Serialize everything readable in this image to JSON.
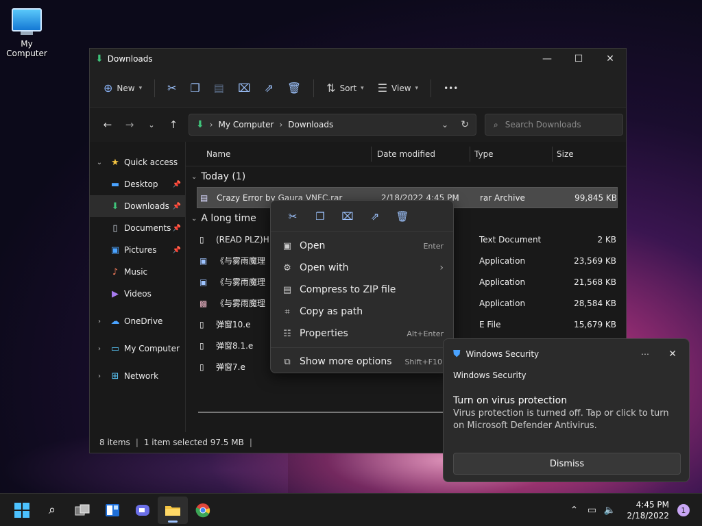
{
  "desktop": {
    "icon_label": "My Computer"
  },
  "window": {
    "title": "Downloads"
  },
  "commandbar": {
    "new_label": "New",
    "sort_label": "Sort",
    "view_label": "View",
    "more_glyph": "•••"
  },
  "address": {
    "root": "My Computer",
    "current": "Downloads"
  },
  "search": {
    "placeholder": "Search Downloads"
  },
  "nav": {
    "quick_access": "Quick access",
    "items": [
      {
        "label": "Desktop"
      },
      {
        "label": "Downloads"
      },
      {
        "label": "Documents"
      },
      {
        "label": "Pictures"
      },
      {
        "label": "Music"
      },
      {
        "label": "Videos"
      }
    ],
    "onedrive": "OneDrive",
    "my_computer": "My Computer",
    "network": "Network"
  },
  "columns": {
    "name": "Name",
    "date": "Date modified",
    "type": "Type",
    "size": "Size"
  },
  "groups": {
    "today": "Today (1)",
    "long_ago": "A long time"
  },
  "files_today": [
    {
      "name": "Crazy Error by Gaura VNFC.rar",
      "date": "2/18/2022 4:45 PM",
      "type": "rar Archive",
      "size": "99,845 KB"
    }
  ],
  "files_old": [
    {
      "name": "(READ PLZ)H",
      "date": "M",
      "type": "Text Document",
      "size": "2 KB"
    },
    {
      "name": "《与雾雨魔理",
      "date": "M",
      "type": "Application",
      "size": "23,569 KB"
    },
    {
      "name": "《与雾雨魔理",
      "date": "M",
      "type": "Application",
      "size": "21,568 KB"
    },
    {
      "name": "《与雾雨魔理",
      "date": "M",
      "type": "Application",
      "size": "28,584 KB"
    },
    {
      "name": "弹窗10.e",
      "date": "M",
      "type": "E File",
      "size": "15,679 KB"
    },
    {
      "name": "弹窗8.1.e",
      "date": "",
      "type": "",
      "size": ""
    },
    {
      "name": "弹窗7.e",
      "date": "",
      "type": "",
      "size": ""
    }
  ],
  "status": {
    "count": "8 items",
    "selection": "1 item selected  97.5 MB"
  },
  "context_menu": {
    "open": "Open",
    "open_sc": "Enter",
    "open_with": "Open with",
    "compress": "Compress to ZIP file",
    "copy_path": "Copy as path",
    "properties": "Properties",
    "properties_sc": "Alt+Enter",
    "more": "Show more options",
    "more_sc": "Shift+F10"
  },
  "toast": {
    "app": "Windows Security",
    "subtitle": "Windows Security",
    "heading": "Turn on virus protection",
    "message": "Virus protection is turned off. Tap or click to turn on Microsoft Defender Antivirus.",
    "dismiss": "Dismiss"
  },
  "taskbar": {
    "time": "4:45 PM",
    "date": "2/18/2022",
    "notifications": "1"
  }
}
